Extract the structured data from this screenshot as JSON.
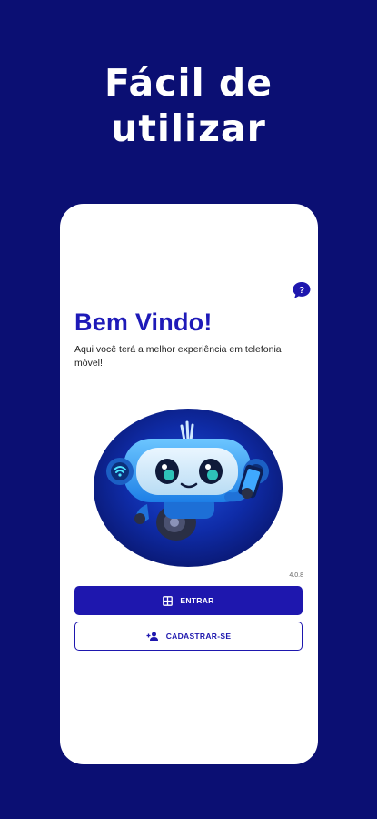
{
  "promo": {
    "title_line1": "Fácil de",
    "title_line2": "utilizar"
  },
  "screen": {
    "help_icon": "help-chat-icon",
    "welcome_title": "Bem Vindo!",
    "welcome_subtitle": "Aqui você terá a melhor experiência em telefonia móvel!",
    "version": "4.0.8",
    "login_button": {
      "label": "ENTRAR",
      "icon": "login-grid-icon"
    },
    "register_button": {
      "label": "CADASTRAR-SE",
      "icon": "add-user-icon"
    }
  },
  "colors": {
    "background": "#0b0f73",
    "brand": "#1e17ae",
    "title": "#1e1ab8",
    "card": "#ffffff"
  }
}
